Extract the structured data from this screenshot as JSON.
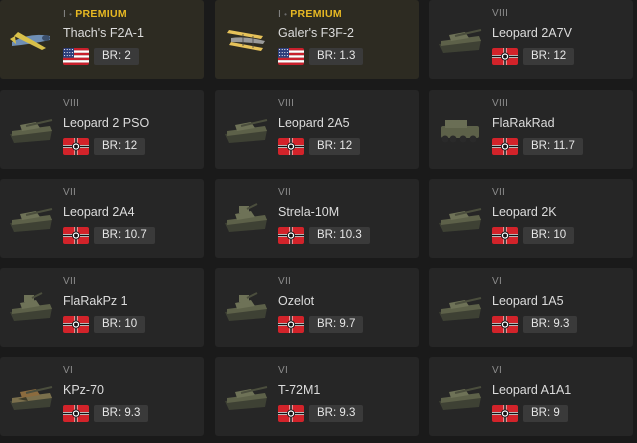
{
  "vehicles": [
    {
      "rank": "I",
      "premium": true,
      "premium_label": "PREMIUM",
      "name": "Thach's F2A-1",
      "nation": "usa",
      "br": "BR: 2",
      "kind": "plane-blue"
    },
    {
      "rank": "I",
      "premium": true,
      "premium_label": "PREMIUM",
      "name": "Galer's F3F-2",
      "nation": "usa",
      "br": "BR: 1.3",
      "kind": "biplane"
    },
    {
      "rank": "VIII",
      "name": "Leopard 2A7V",
      "nation": "germany",
      "br": "BR: 12",
      "kind": "tank"
    },
    {
      "rank": "VIII",
      "name": "Leopard 2 PSO",
      "nation": "germany",
      "br": "BR: 12",
      "kind": "tank"
    },
    {
      "rank": "VIII",
      "name": "Leopard 2A5",
      "nation": "germany",
      "br": "BR: 12",
      "kind": "tank"
    },
    {
      "rank": "VIII",
      "name": "FlaRakRad",
      "nation": "germany",
      "br": "BR: 11.7",
      "kind": "truck"
    },
    {
      "rank": "VII",
      "name": "Leopard 2A4",
      "nation": "germany",
      "br": "BR: 10.7",
      "kind": "tank"
    },
    {
      "rank": "VII",
      "name": "Strela-10M",
      "nation": "germany",
      "br": "BR: 10.3",
      "kind": "spaa"
    },
    {
      "rank": "VII",
      "name": "Leopard 2K",
      "nation": "germany",
      "br": "BR: 10",
      "kind": "tank"
    },
    {
      "rank": "VII",
      "name": "FlaRakPz 1",
      "nation": "germany",
      "br": "BR: 10",
      "kind": "spaa"
    },
    {
      "rank": "VII",
      "name": "Ozelot",
      "nation": "germany",
      "br": "BR: 9.7",
      "kind": "spaa"
    },
    {
      "rank": "VI",
      "name": "Leopard 1A5",
      "nation": "germany",
      "br": "BR: 9.3",
      "kind": "tank"
    },
    {
      "rank": "VI",
      "name": "KPz-70",
      "nation": "germany",
      "br": "BR: 9.3",
      "kind": "tank-camo"
    },
    {
      "rank": "VI",
      "name": "T-72M1",
      "nation": "germany",
      "br": "BR: 9.3",
      "kind": "tank"
    },
    {
      "rank": "VI",
      "name": "Leopard A1A1",
      "nation": "germany",
      "br": "BR: 9",
      "kind": "tank"
    }
  ],
  "colors": {
    "premium": "#e8b923",
    "card": "#262626",
    "premium_card": "#2d2b22"
  }
}
